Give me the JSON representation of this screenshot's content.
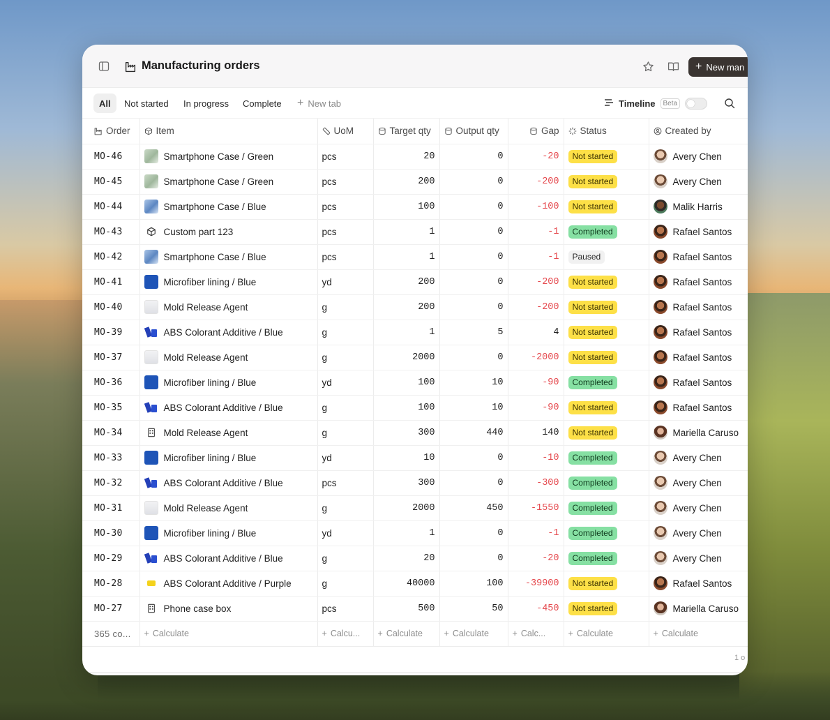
{
  "header": {
    "title": "Manufacturing orders",
    "new_button_label": "New man"
  },
  "tabs": [
    {
      "label": "All",
      "active": true
    },
    {
      "label": "Not started"
    },
    {
      "label": "In progress"
    },
    {
      "label": "Complete"
    },
    {
      "label": "New tab"
    }
  ],
  "toolbar": {
    "timeline_label": "Timeline",
    "beta_label": "Beta",
    "timeline_enabled": false
  },
  "columns": {
    "order": "Order",
    "item": "Item",
    "uom": "UoM",
    "target_qty": "Target qty",
    "output_qty": "Output qty",
    "gap": "Gap",
    "status": "Status",
    "created_by": "Created by"
  },
  "rows": [
    {
      "order": "MO-46",
      "item": "Smartphone Case / Green",
      "thumb": "case-green",
      "uom": "pcs",
      "target": "20",
      "output": "0",
      "gap": "-20",
      "status": "Not started",
      "created_by": "Avery Chen"
    },
    {
      "order": "MO-45",
      "item": "Smartphone Case / Green",
      "thumb": "case-green",
      "uom": "pcs",
      "target": "200",
      "output": "0",
      "gap": "-200",
      "status": "Not started",
      "created_by": "Avery Chen"
    },
    {
      "order": "MO-44",
      "item": "Smartphone Case / Blue",
      "thumb": "case-blue",
      "uom": "pcs",
      "target": "100",
      "output": "0",
      "gap": "-100",
      "status": "Not started",
      "created_by": "Malik Harris"
    },
    {
      "order": "MO-43",
      "item": "Custom part 123",
      "thumb": "cube",
      "uom": "pcs",
      "target": "1",
      "output": "0",
      "gap": "-1",
      "status": "Completed",
      "created_by": "Rafael Santos"
    },
    {
      "order": "MO-42",
      "item": "Smartphone Case / Blue",
      "thumb": "case-blue",
      "uom": "pcs",
      "target": "1",
      "output": "0",
      "gap": "-1",
      "status": "Paused",
      "created_by": "Rafael Santos"
    },
    {
      "order": "MO-41",
      "item": "Microfiber lining / Blue",
      "thumb": "lining",
      "uom": "yd",
      "target": "200",
      "output": "0",
      "gap": "-200",
      "status": "Not started",
      "created_by": "Rafael Santos"
    },
    {
      "order": "MO-40",
      "item": "Mold Release Agent",
      "thumb": "mold",
      "uom": "g",
      "target": "200",
      "output": "0",
      "gap": "-200",
      "status": "Not started",
      "created_by": "Rafael Santos"
    },
    {
      "order": "MO-39",
      "item": "ABS Colorant Additive / Blue",
      "thumb": "abs-blue",
      "uom": "g",
      "target": "1",
      "output": "5",
      "gap": "4",
      "status": "Not started",
      "created_by": "Rafael Santos"
    },
    {
      "order": "MO-37",
      "item": "Mold Release Agent",
      "thumb": "mold",
      "uom": "g",
      "target": "2000",
      "output": "0",
      "gap": "-2000",
      "status": "Not started",
      "created_by": "Rafael Santos"
    },
    {
      "order": "MO-36",
      "item": "Microfiber lining / Blue",
      "thumb": "lining",
      "uom": "yd",
      "target": "100",
      "output": "10",
      "gap": "-90",
      "status": "Completed",
      "created_by": "Rafael Santos"
    },
    {
      "order": "MO-35",
      "item": "ABS Colorant Additive / Blue",
      "thumb": "abs-blue",
      "uom": "g",
      "target": "100",
      "output": "10",
      "gap": "-90",
      "status": "Not started",
      "created_by": "Rafael Santos"
    },
    {
      "order": "MO-34",
      "item": "Mold Release Agent",
      "thumb": "building",
      "uom": "g",
      "target": "300",
      "output": "440",
      "gap": "140",
      "status": "Not started",
      "created_by": "Mariella Caruso"
    },
    {
      "order": "MO-33",
      "item": "Microfiber lining / Blue",
      "thumb": "lining",
      "uom": "yd",
      "target": "10",
      "output": "0",
      "gap": "-10",
      "status": "Completed",
      "created_by": "Avery Chen"
    },
    {
      "order": "MO-32",
      "item": "ABS Colorant Additive / Blue",
      "thumb": "abs-blue",
      "uom": "pcs",
      "target": "300",
      "output": "0",
      "gap": "-300",
      "status": "Completed",
      "created_by": "Avery Chen"
    },
    {
      "order": "MO-31",
      "item": "Mold Release Agent",
      "thumb": "mold",
      "uom": "g",
      "target": "2000",
      "output": "450",
      "gap": "-1550",
      "status": "Completed",
      "created_by": "Avery Chen"
    },
    {
      "order": "MO-30",
      "item": "Microfiber lining / Blue",
      "thumb": "lining",
      "uom": "yd",
      "target": "1",
      "output": "0",
      "gap": "-1",
      "status": "Completed",
      "created_by": "Avery Chen"
    },
    {
      "order": "MO-29",
      "item": "ABS Colorant Additive / Blue",
      "thumb": "abs-blue",
      "uom": "g",
      "target": "20",
      "output": "0",
      "gap": "-20",
      "status": "Completed",
      "created_by": "Avery Chen"
    },
    {
      "order": "MO-28",
      "item": "ABS Colorant Additive / Purple",
      "thumb": "abs-yellow",
      "uom": "g",
      "target": "40000",
      "output": "100",
      "gap": "-39900",
      "status": "Not started",
      "created_by": "Rafael Santos"
    },
    {
      "order": "MO-27",
      "item": "Phone case box",
      "thumb": "building",
      "uom": "pcs",
      "target": "500",
      "output": "50",
      "gap": "-450",
      "status": "Not started",
      "created_by": "Mariella Caruso"
    }
  ],
  "footer": {
    "count": "365 co...",
    "calc_item": "Calculate",
    "calc_uom": "Calcu...",
    "calc_target": "Calculate",
    "calc_output": "Calculate",
    "calc_gap": "Calc...",
    "calc_status": "Calculate",
    "calc_created": "Calculate"
  },
  "pager_text": "1 o",
  "colors": {
    "negative": "#e5484d",
    "not_started": "#fde047",
    "completed": "#86e0a3",
    "paused": "#f1f1f1",
    "primary_button": "#3a3431"
  }
}
